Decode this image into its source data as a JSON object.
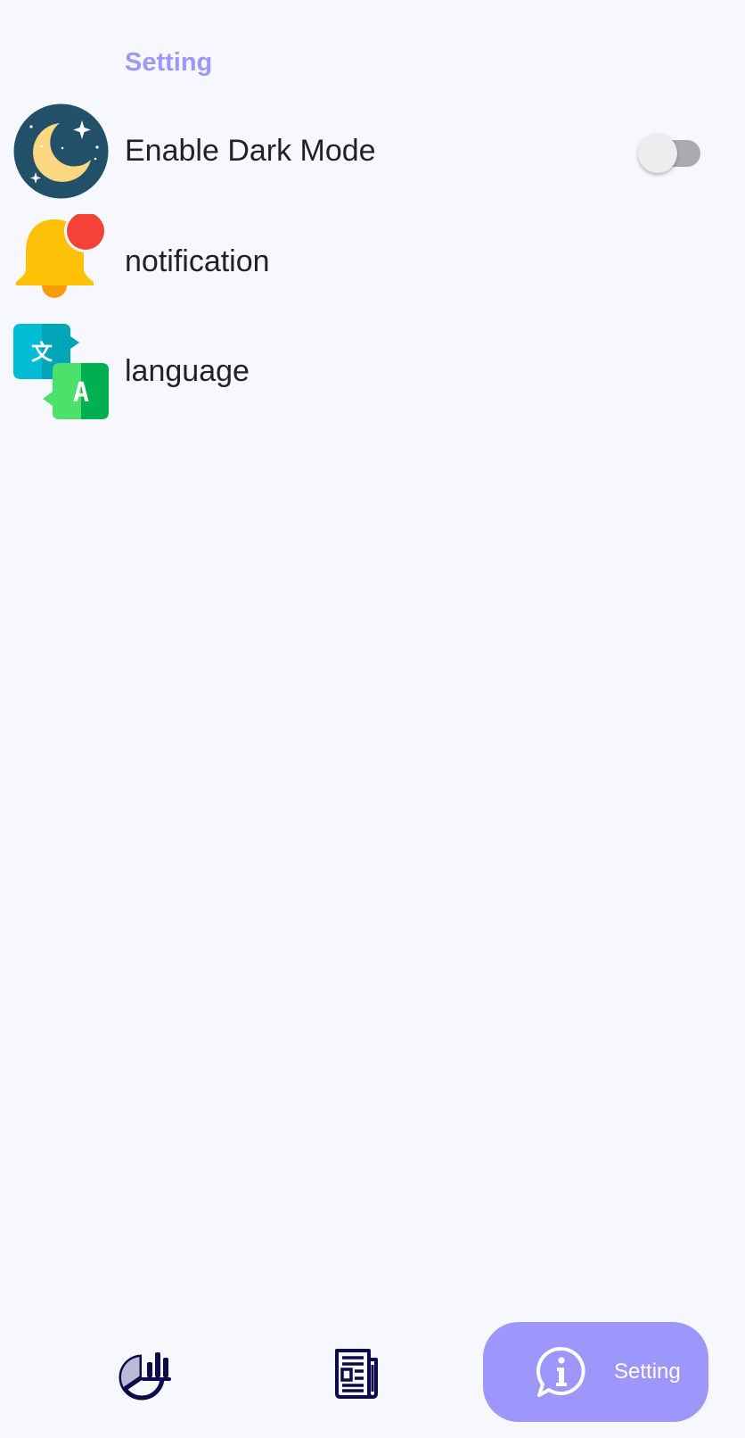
{
  "header": {
    "title": "Setting"
  },
  "settings": {
    "items": [
      {
        "label": "Enable Dark Mode",
        "icon": "moon-icon",
        "has_toggle": true,
        "toggle_on": false
      },
      {
        "label": "notification",
        "icon": "bell-icon"
      },
      {
        "label": "language",
        "icon": "translate-icon"
      }
    ]
  },
  "bottom_nav": {
    "items": [
      {
        "icon": "chart-icon",
        "label": ""
      },
      {
        "icon": "newspaper-icon",
        "label": ""
      },
      {
        "icon": "info-icon",
        "label": "Setting",
        "active": true
      }
    ]
  },
  "colors": {
    "accent": "#9e97fb",
    "title": "#9c97f9",
    "background": "#f7f8fd",
    "nav_icon": "#0d0b4a",
    "toggle_track": "#aaaab0",
    "toggle_thumb": "#ededee"
  }
}
